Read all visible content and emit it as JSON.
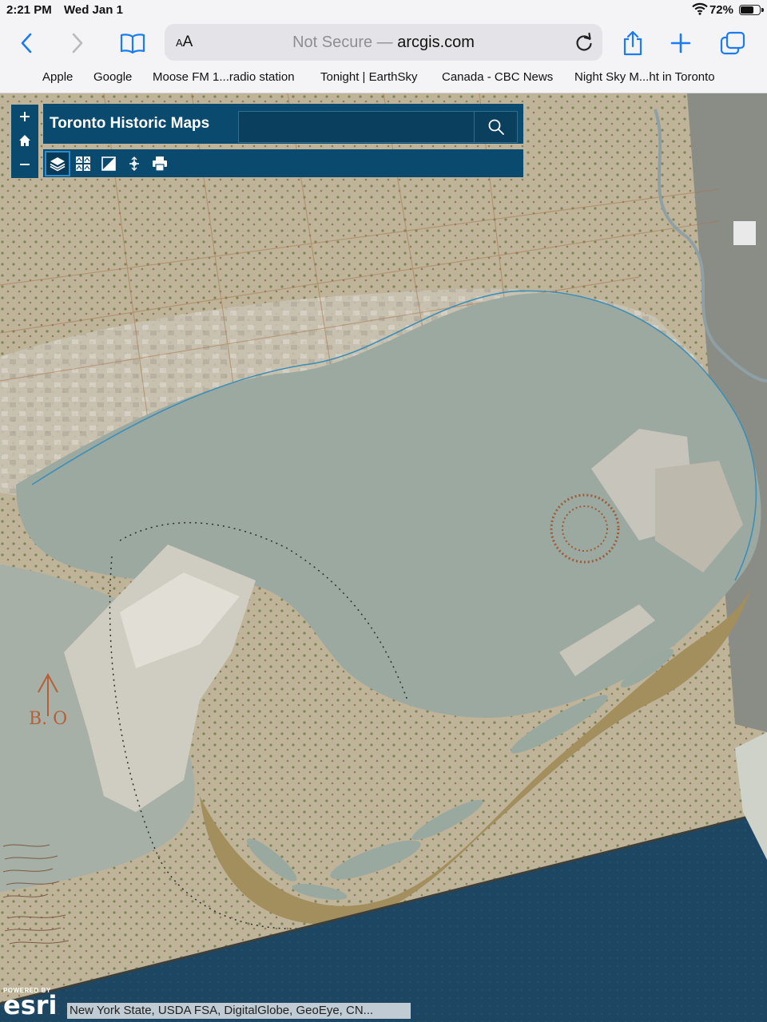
{
  "status_bar": {
    "time": "2:21 PM",
    "date": "Wed Jan 1",
    "battery_text": "72%",
    "battery_level": 0.72
  },
  "browser": {
    "text_size_label": "AA",
    "security_label": "Not Secure —",
    "domain": "arcgis.com",
    "accent_color": "#1a7cf0"
  },
  "favorites": [
    {
      "label": "Apple"
    },
    {
      "label": "Google"
    },
    {
      "label": "Moose FM 1...radio station"
    },
    {
      "label": "Tonight | EarthSky"
    },
    {
      "label": "Canada - CBC News"
    },
    {
      "label": "Night Sky M...ht in Toronto"
    }
  ],
  "map_app": {
    "title": "Toronto Historic Maps",
    "header_color": "#0b4a6f",
    "search_value": "",
    "zoom_controls": [
      "+",
      "home",
      "−"
    ],
    "tools": [
      {
        "icon": "layers-icon",
        "active": true
      },
      {
        "icon": "basemap-gallery-icon",
        "active": false
      },
      {
        "icon": "swipe-icon",
        "active": false
      },
      {
        "icon": "measure-icon",
        "active": false
      },
      {
        "icon": "print-icon",
        "active": false
      }
    ]
  },
  "map": {
    "historic_label": "B. O",
    "powered_by": "POWERED BY",
    "logo": "esri",
    "attribution": "New York State, USDA FSA, DigitalGlobe, GeoEye, CN..."
  }
}
